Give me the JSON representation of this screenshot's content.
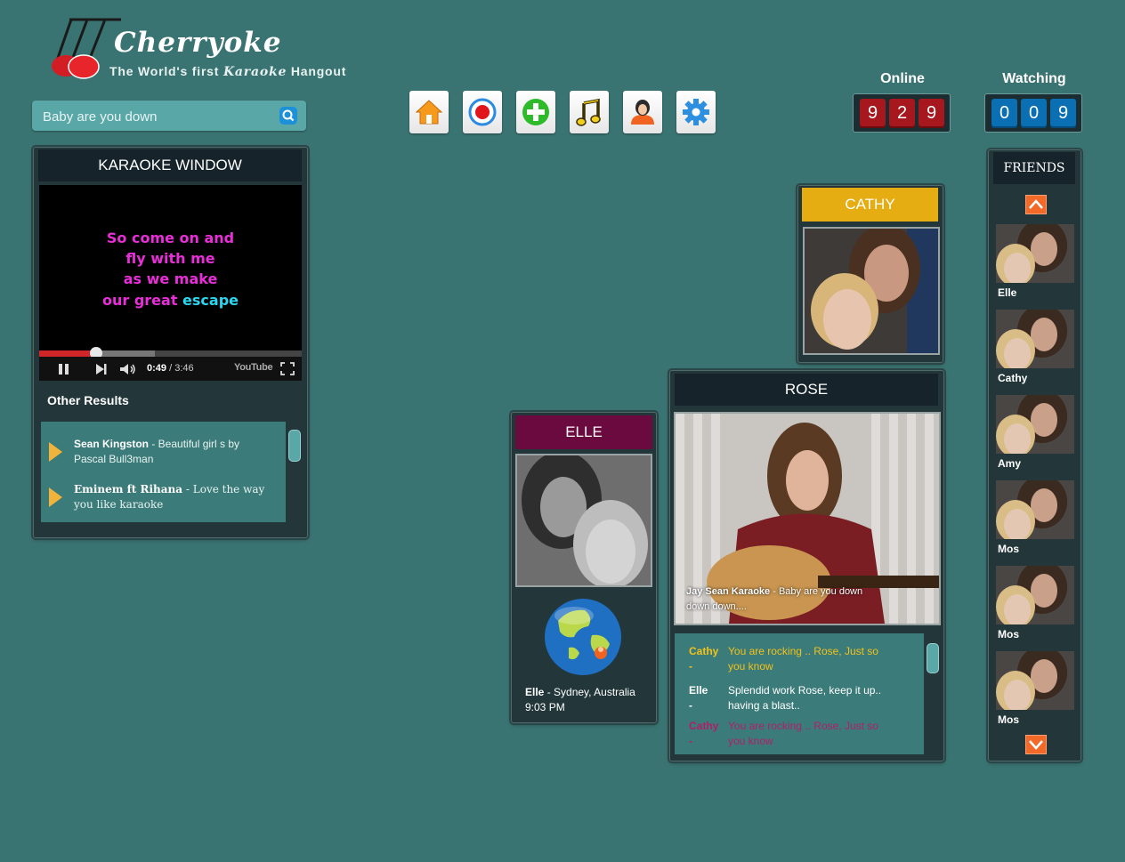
{
  "app": {
    "name": "Cherryoke",
    "tagline_prefix": "The World's first ",
    "tagline_karaoke": "Karaoke",
    "tagline_suffix": " Hangout"
  },
  "search": {
    "value": "Baby are you down",
    "icon": "search-icon"
  },
  "toolbar": [
    {
      "icon": "home-icon"
    },
    {
      "icon": "record-icon"
    },
    {
      "icon": "add-icon"
    },
    {
      "icon": "music-note-icon"
    },
    {
      "icon": "user-icon"
    },
    {
      "icon": "settings-gear-icon"
    }
  ],
  "stats": {
    "online_label": "Online",
    "online_digits": [
      "9",
      "2",
      "9"
    ],
    "watching_label": "Watching",
    "watching_digits": [
      "0",
      "0",
      "9"
    ]
  },
  "karaoke_window": {
    "title": "KARAOKE WINDOW",
    "lyrics": [
      "So come on and",
      "fly with me",
      "as we make"
    ],
    "lyric_last_sung": "our great",
    "lyric_last_upcoming": "escape",
    "time_current": "0:49",
    "time_total": " / 3:46",
    "progress": 0.217,
    "youtube_label": "YouTube",
    "other_results_title": "Other Results",
    "results": [
      {
        "artist": "Sean Kingston",
        "title": " - Beautiful girl s by Pascal Bull3man"
      },
      {
        "artist": "Eminem ft Rihana",
        "title": " - Love the way you like karaoke"
      }
    ]
  },
  "cams": {
    "cathy": {
      "name": "CATHY",
      "color": "#e6ad12"
    },
    "elle": {
      "name": "ELLE",
      "color": "#6a0a3e",
      "location_name": "Elle",
      "location_rest": " - Sydney, Australia",
      "local_time": "9:03 PM"
    },
    "rose": {
      "name": "ROSE",
      "now_playing_artist": "Jay Sean Karaoke",
      "now_playing_title": " - Baby are you down down down...."
    }
  },
  "chat": [
    {
      "who": "Cathy -",
      "msg": "You are rocking .. Rose, Just so you  know",
      "color": "#f2c21a"
    },
    {
      "who": "Elle -",
      "msg": "Splendid work Rose, keep it up.. having a blast..",
      "color": "#ffffff"
    },
    {
      "who": "Cathy -",
      "msg": "You are rocking .. Rose, Just so you  know",
      "color": "#b0206a"
    }
  ],
  "friends": {
    "title": "FRIENDS",
    "list": [
      {
        "name": "Elle"
      },
      {
        "name": "Cathy"
      },
      {
        "name": "Amy"
      },
      {
        "name": "Mos"
      },
      {
        "name": "Mos"
      },
      {
        "name": "Mos"
      }
    ]
  }
}
